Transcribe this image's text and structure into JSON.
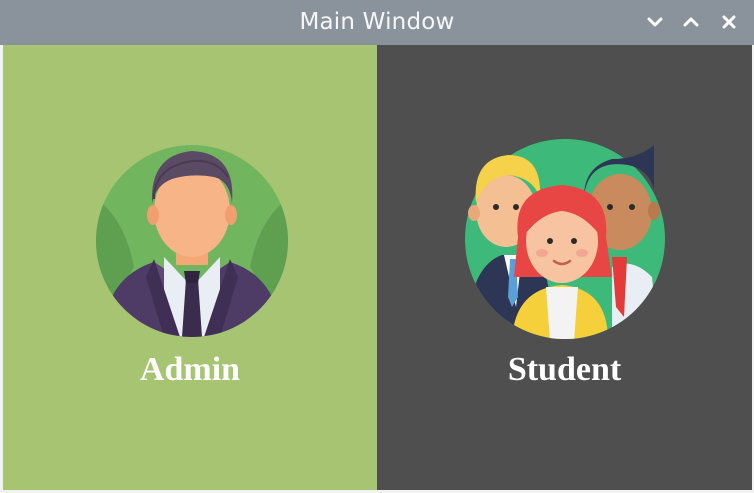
{
  "window": {
    "title": "Main Window",
    "controls": [
      "chevron-down-icon",
      "chevron-up-icon",
      "close-icon"
    ]
  },
  "panels": {
    "admin": {
      "label": "Admin",
      "background": "#a6c471",
      "icon": "admin-avatar-icon"
    },
    "student": {
      "label": "Student",
      "background": "#4f4f4f",
      "icon": "students-group-icon"
    }
  },
  "colors": {
    "titlebar": "#8a939c",
    "title_text": "#f5f7f8",
    "label_text": "#ffffff",
    "avatar_circle_admin": "#72b55f",
    "avatar_circle_student": "#3dba7a"
  }
}
